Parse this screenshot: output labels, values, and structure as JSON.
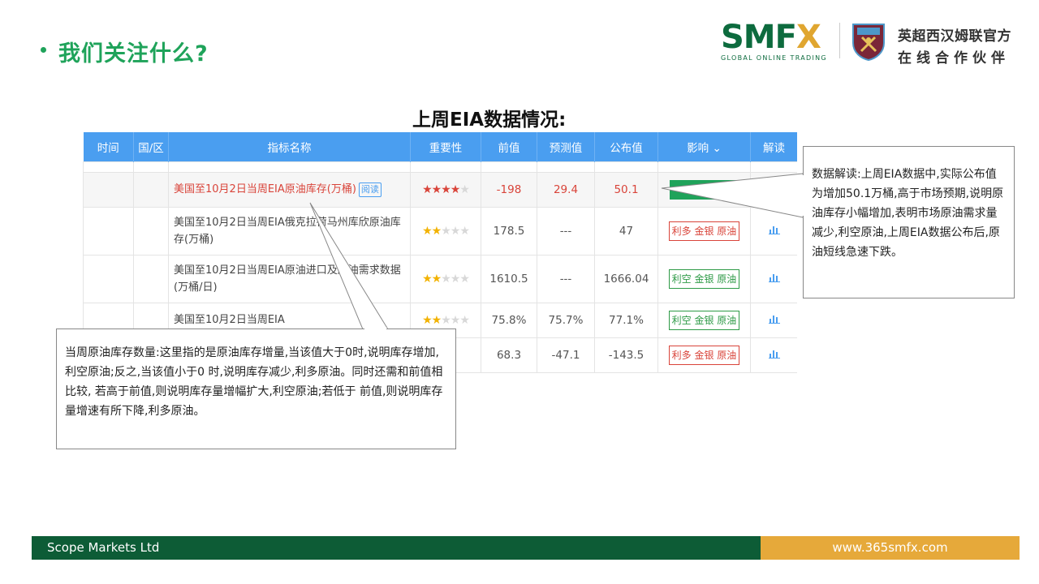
{
  "header": {
    "title": "我们关注什么?",
    "logo_text_main": "SMF",
    "logo_text_x": "X",
    "logo_subtitle": "GLOBAL ONLINE TRADING",
    "partner_line1": "英超西汉姆联官方",
    "partner_line2": "在线合作伙伴"
  },
  "section_title": "上周EIA数据情况:",
  "table": {
    "columns": [
      "时间",
      "国/区",
      "指标名称",
      "重要性",
      "前值",
      "预测值",
      "公布值",
      "影响",
      "解读"
    ],
    "impact_caret": "⌄",
    "rows": [
      {
        "name": "美国至10月2日当周EIA原油库存(万桶)",
        "tag": "阅读",
        "stars": "★★★★",
        "stars_off": "★",
        "prev": "-198",
        "forecast": "29.4",
        "actual": "50.1",
        "impact": ""
      },
      {
        "name": "美国至10月2日当周EIA俄克拉荷马州库欣原油库存(万桶)",
        "tag": "",
        "stars": "★★",
        "stars_off": "★★★",
        "prev": "178.5",
        "forecast": "---",
        "actual": "47",
        "impact": "利多 金银 原油"
      },
      {
        "name": "美国至10月2日当周EIA原油进口及原油需求数据(万桶/日)",
        "tag": "",
        "stars": "★★",
        "stars_off": "★★★",
        "prev": "1610.5",
        "forecast": "---",
        "actual": "1666.04",
        "impact": "利空 金银 原油"
      },
      {
        "name": "美国至10月2日当周EIA",
        "tag": "",
        "stars": "★★",
        "stars_off": "★★★",
        "prev": "75.8%",
        "forecast": "75.7%",
        "actual": "77.1%",
        "impact": "利空 金银 原油"
      },
      {
        "name": "",
        "tag": "",
        "stars": "",
        "stars_off": "★★",
        "prev": "68.3",
        "forecast": "-47.1",
        "actual": "-143.5",
        "impact": "利多 金银 原油"
      }
    ]
  },
  "callout_right": "数据解读:上周EIA数据中,实际公布值为增加50.1万桶,高于市场预期,说明原油库存小幅增加,表明市场原油需求量减少,利空原油,上周EIA数据公布后,原油短线急速下跌。",
  "callout_left": "当周原油库存数量:这里指的是原油库存增量,当该值大于0时,说明库存增加,利空原油;反之,当该值小于0 时,说明库存减少,利多原油。同时还需和前值相比较, 若高于前值,则说明库存量增幅扩大,利空原油;若低于 前值,则说明库存量增速有所下降,利多原油。",
  "footer": {
    "company": "Scope Markets Ltd",
    "website": "www.365smfx.com"
  },
  "colors": {
    "brand_green": "#0d5c36",
    "accent_green": "#1fa35a",
    "gold": "#e6a93a",
    "table_header_blue": "#4a9ef0",
    "bearish_red": "#d9443a"
  }
}
